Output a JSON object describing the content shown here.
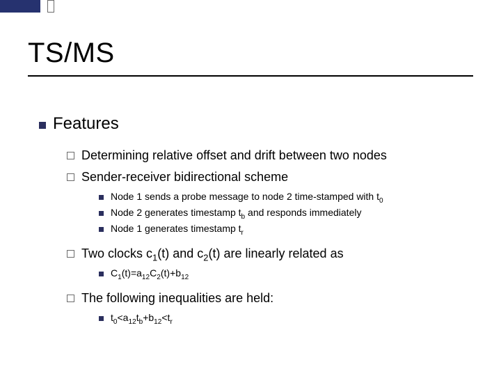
{
  "title": "TS/MS",
  "features_label": "Features",
  "bullets": {
    "determining": "Determining relative offset and drift between two nodes",
    "scheme": "Sender-receiver bidirectional scheme",
    "probe_pre": "Node 1 sends a probe message to node 2 time-stamped with t",
    "probe_sub": "0",
    "node2_pre": "Node 2 generates timestamp t",
    "node2_sub": "b",
    "node2_post": " and responds immediately",
    "node1_pre": "Node 1 generates timestamp t",
    "node1_sub": "r",
    "clocks_p1": "Two clocks c",
    "clocks_s1": "1",
    "clocks_p2": "(t) and c",
    "clocks_s2": "2",
    "clocks_p3": "(t) are linearly related as",
    "eq_p1": "C",
    "eq_s1": "1",
    "eq_p2": "(t)=a",
    "eq_s2": "12",
    "eq_p3": "C",
    "eq_s3": "2",
    "eq_p4": "(t)+b",
    "eq_s4": "12",
    "ineq_label": "The following inequalities are held:",
    "in_p1": "t",
    "in_s1": "0",
    "in_p2": "<a",
    "in_s2": "12",
    "in_p3": "t",
    "in_s3": "b",
    "in_p4": "+b",
    "in_s4": "12",
    "in_p5": "<t",
    "in_s5": "r"
  }
}
